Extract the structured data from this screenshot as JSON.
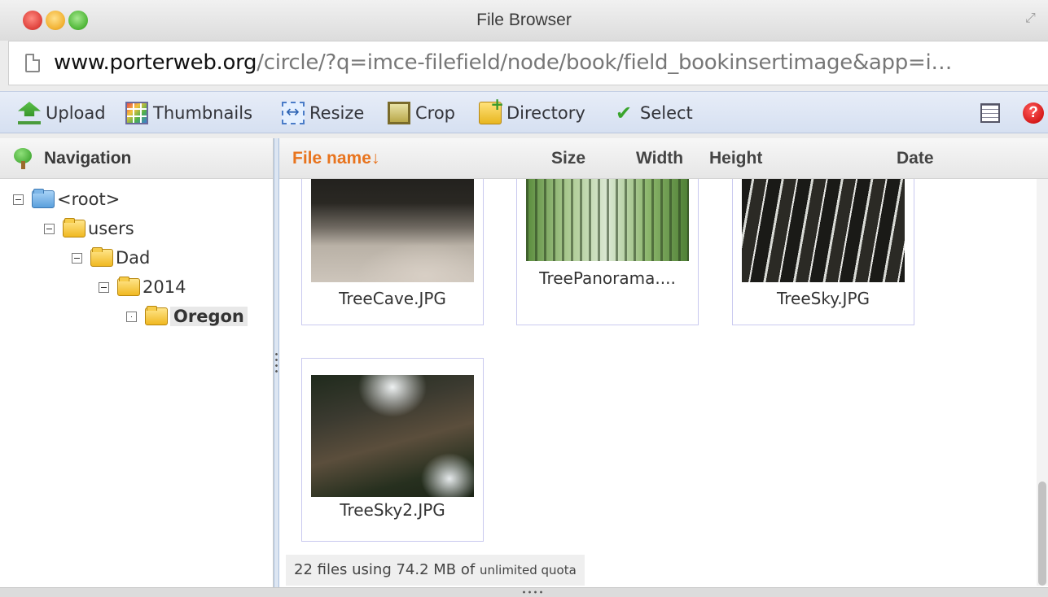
{
  "window": {
    "title": "File Browser"
  },
  "url": {
    "host": "www.porterweb.org",
    "path": "/circle/?q=imce-filefield/node/book/field_bookinsertimage&app=i…"
  },
  "toolbar": {
    "upload": "Upload",
    "thumbnails": "Thumbnails",
    "resize": "Resize",
    "crop": "Crop",
    "directory": "Directory",
    "select": "Select"
  },
  "navigation": {
    "title": "Navigation",
    "tree": [
      {
        "label": "<root>",
        "depth": 0,
        "folder": "blue"
      },
      {
        "label": "users",
        "depth": 1,
        "folder": "yellow"
      },
      {
        "label": "Dad",
        "depth": 2,
        "folder": "yellow"
      },
      {
        "label": "2014",
        "depth": 3,
        "folder": "yellow"
      },
      {
        "label": "Oregon",
        "depth": 4,
        "folder": "yellow",
        "selected": true
      }
    ]
  },
  "columns": {
    "name": "File name↓",
    "size": "Size",
    "width": "Width",
    "height": "Height",
    "date": "Date"
  },
  "files": [
    {
      "name": "TreeCave.JPG"
    },
    {
      "name": "TreePanorama...."
    },
    {
      "name": "TreeSky.JPG"
    },
    {
      "name": "TreeSky2.JPG"
    }
  ],
  "status": {
    "main": "22 files using 74.2 MB of",
    "quota": "unlimited quota"
  },
  "colors": {
    "accent": "#e8741e",
    "toolbar": "#dbe3f3",
    "card_border": "#c9c9ef"
  }
}
